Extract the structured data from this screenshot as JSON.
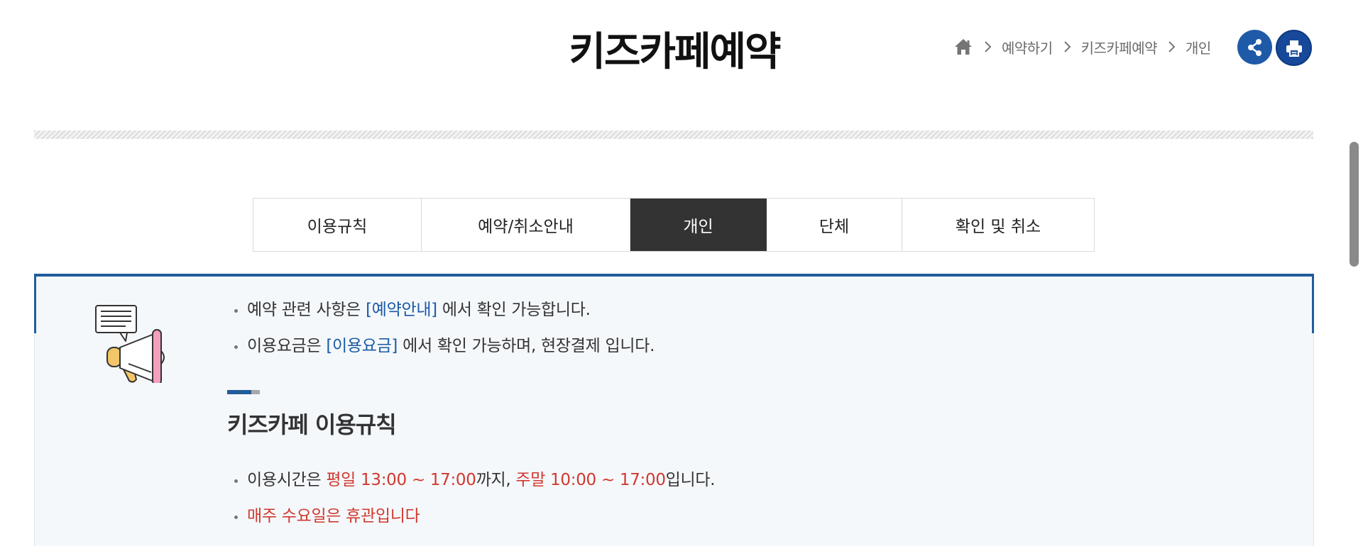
{
  "page": {
    "title": "키즈카페예약"
  },
  "breadcrumb": {
    "home_icon": "home-icon",
    "items": [
      "예약하기",
      "키즈카페예약",
      "개인"
    ]
  },
  "actions": {
    "share_icon": "share-icon",
    "print_icon": "print-icon"
  },
  "tabs": [
    {
      "label": "이용규칙",
      "active": false
    },
    {
      "label": "예약/취소안내",
      "active": false
    },
    {
      "label": "개인",
      "active": true
    },
    {
      "label": "단체",
      "active": false
    },
    {
      "label": "확인 및 취소",
      "active": false
    }
  ],
  "notice": {
    "icon": "megaphone-icon",
    "lines": [
      {
        "prefix": "예약 관련 사항은 ",
        "link": "[예약안내]",
        "suffix": " 에서 확인 가능합니다."
      },
      {
        "prefix": "이용요금은 ",
        "link": "[이용요금]",
        "suffix": " 에서 확인 가능하며, 현장결제 입니다."
      }
    ],
    "section_title": "키즈카페 이용규칙",
    "rules": {
      "hours": {
        "prefix": "이용시간은 ",
        "weekday": "평일 13:00 ~ 17:00",
        "mid": "까지, ",
        "weekend": "주말 10:00 ~ 17:00",
        "suffix": "입니다."
      },
      "closed": "매주 수요일은 휴관입니다"
    }
  },
  "colors": {
    "accent_blue": "#225c9c",
    "link_blue": "#1b5aa6",
    "highlight_red": "#d0392f",
    "active_tab": "#333333",
    "share_button": "#1f5aa8",
    "print_button": "#17489a"
  }
}
